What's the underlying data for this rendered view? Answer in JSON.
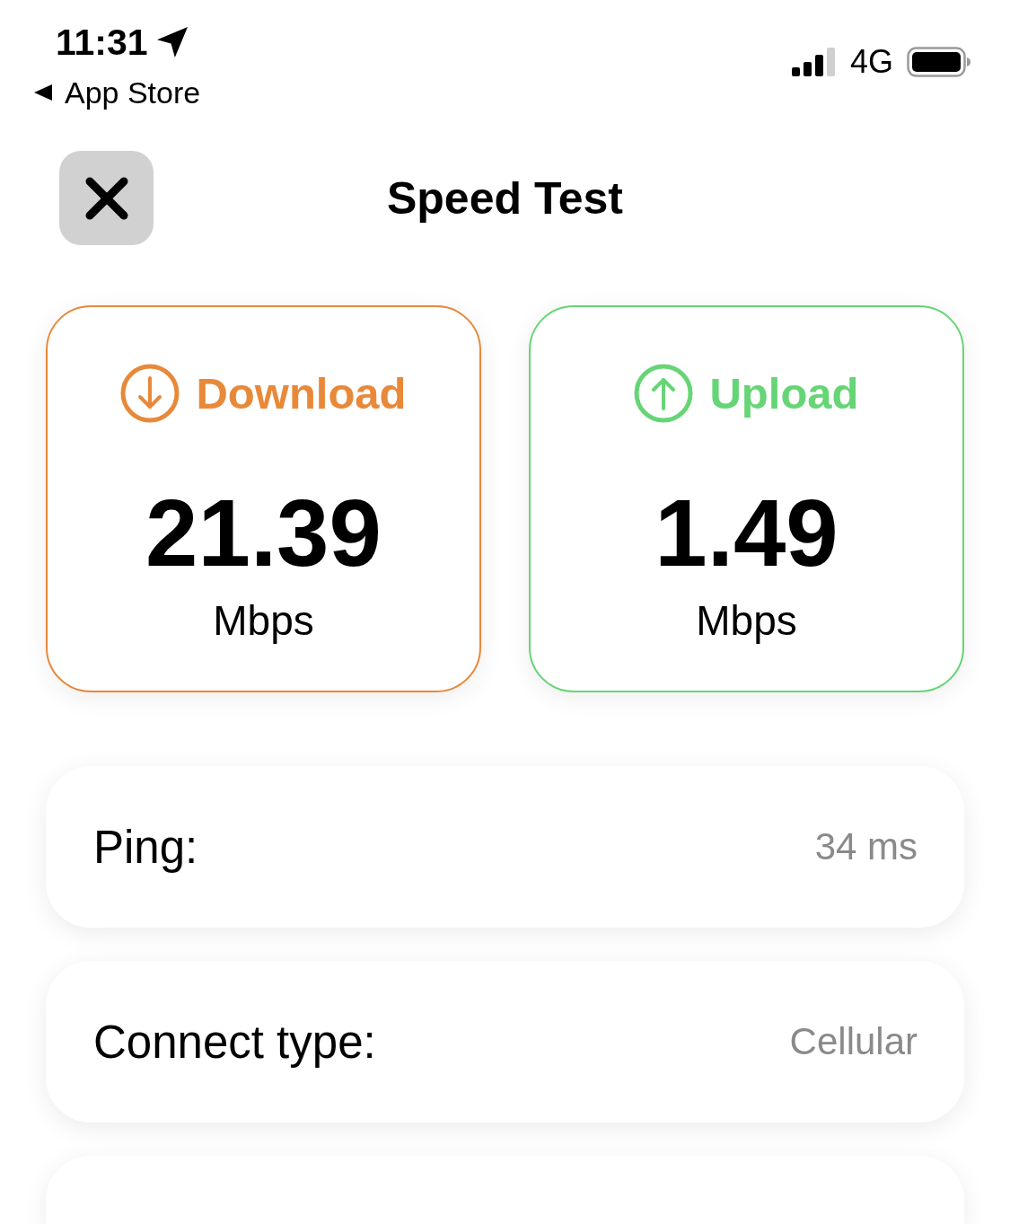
{
  "status_bar": {
    "time": "11:31",
    "back_label": "App Store",
    "network": "4G"
  },
  "header": {
    "title": "Speed Test"
  },
  "speed_cards": [
    {
      "kind": "download",
      "label": "Download",
      "value": "21.39",
      "unit": "Mbps",
      "color": "#e8893a"
    },
    {
      "kind": "upload",
      "label": "Upload",
      "value": "1.49",
      "unit": "Mbps",
      "color": "#66d575"
    }
  ],
  "details": [
    {
      "label": "Ping:",
      "value": "34 ms"
    },
    {
      "label": "Connect type:",
      "value": "Cellular"
    }
  ]
}
